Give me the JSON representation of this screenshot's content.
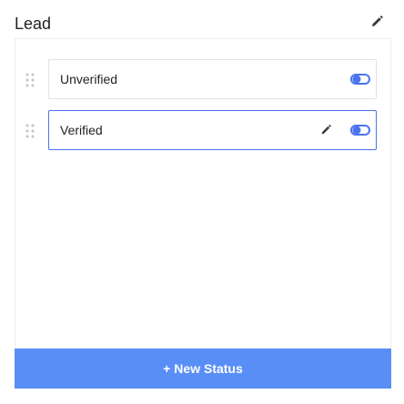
{
  "panel": {
    "title": "Lead"
  },
  "statuses": [
    {
      "label": "Unverified",
      "active": false,
      "show_edit": false
    },
    {
      "label": "Verified",
      "active": true,
      "show_edit": true
    }
  ],
  "new_status_label": "+ New Status",
  "icons": {
    "header_edit": "pencil-icon",
    "row_edit": "pencil-icon",
    "drag": "drag-handle-icon",
    "toggle": "toggle-icon"
  },
  "colors": {
    "accent": "#5a8ef7",
    "active_border": "#4a74ee",
    "icon": "#4a74ee"
  }
}
